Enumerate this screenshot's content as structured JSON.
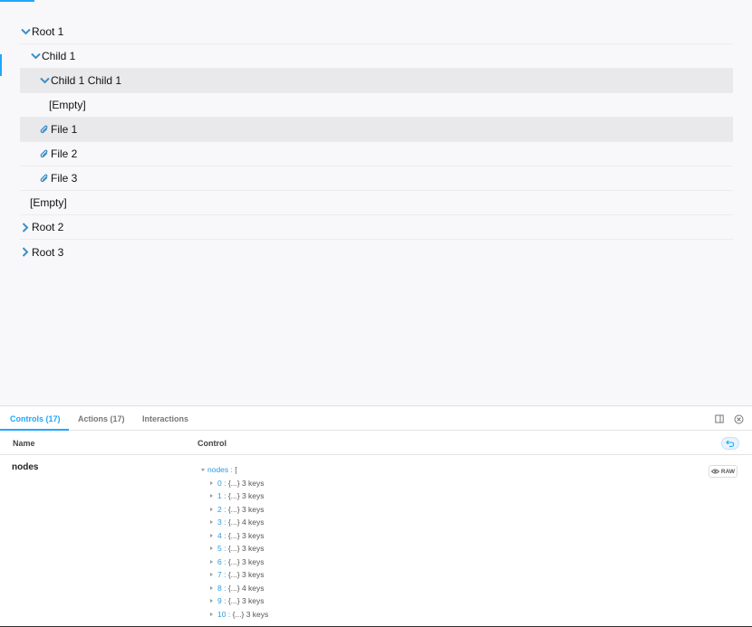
{
  "tree": {
    "rows": [
      {
        "label": "Root 1",
        "icon": "chevron-down-icon"
      },
      {
        "label": "Child 1",
        "icon": "chevron-down-icon"
      },
      {
        "label": "Child 1 Child 1",
        "icon": "chevron-down-icon"
      },
      {
        "label": "[Empty]",
        "icon": ""
      },
      {
        "label": "File 1",
        "icon": "paperclip-icon"
      },
      {
        "label": "File 2",
        "icon": "paperclip-icon"
      },
      {
        "label": "File 3",
        "icon": "paperclip-icon"
      },
      {
        "label": "[Empty]",
        "icon": ""
      },
      {
        "label": "Root 2",
        "icon": "chevron-right-icon"
      },
      {
        "label": "Root 3",
        "icon": "chevron-right-icon"
      }
    ]
  },
  "addons": {
    "tabs": [
      {
        "label": "Controls (17)",
        "active": true
      },
      {
        "label": "Actions (17)",
        "active": false
      },
      {
        "label": "Interactions",
        "active": false
      }
    ],
    "columns": {
      "name": "Name",
      "control": "Control"
    },
    "row": {
      "name": "nodes",
      "json_key": "nodes",
      "json_open": "[",
      "items": [
        {
          "key": "0",
          "value": "{...}",
          "count": "3 keys"
        },
        {
          "key": "1",
          "value": "{...}",
          "count": "3 keys"
        },
        {
          "key": "2",
          "value": "{...}",
          "count": "3 keys"
        },
        {
          "key": "3",
          "value": "{...}",
          "count": "4 keys"
        },
        {
          "key": "4",
          "value": "{...}",
          "count": "3 keys"
        },
        {
          "key": "5",
          "value": "{...}",
          "count": "3 keys"
        },
        {
          "key": "6",
          "value": "{...}",
          "count": "3 keys"
        },
        {
          "key": "7",
          "value": "{...}",
          "count": "3 keys"
        },
        {
          "key": "8",
          "value": "{...}",
          "count": "4 keys"
        },
        {
          "key": "9",
          "value": "{...}",
          "count": "3 keys"
        },
        {
          "key": "10",
          "value": "{...}",
          "count": "3 keys"
        }
      ],
      "raw_label": "RAW"
    }
  },
  "colors": {
    "accent": "#1ea7fd",
    "chevron": "#3d8fc6",
    "highlight": "#e9e9ec"
  }
}
